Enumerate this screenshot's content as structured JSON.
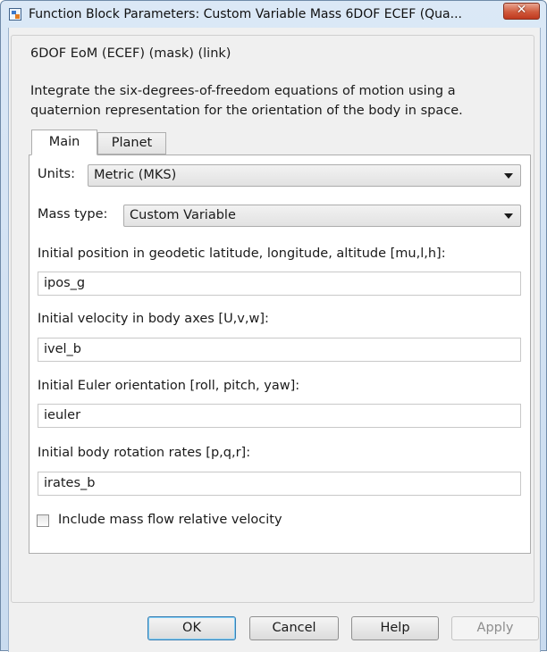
{
  "window": {
    "title": "Function Block Parameters: Custom Variable Mass 6DOF ECEF (Qua...",
    "close_glyph": "✕"
  },
  "block": {
    "group_title": "6DOF EoM (ECEF) (mask) (link)",
    "description_line1": "Integrate the six-degrees-of-freedom equations of motion using a",
    "description_line2": "quaternion representation for the orientation of the body in space."
  },
  "tabs": [
    {
      "label": "Main",
      "selected": true
    },
    {
      "label": "Planet",
      "selected": false
    }
  ],
  "params": {
    "units_label": "Units:",
    "units_value": "Metric (MKS)",
    "mass_type_label": "Mass type:",
    "mass_type_value": "Custom Variable",
    "ipos_label": "Initial position in geodetic latitude, longitude, altitude [mu,l,h]:",
    "ipos_value": "ipos_g",
    "ivel_label": "Initial velocity in body axes [U,v,w]:",
    "ivel_value": "ivel_b",
    "ieuler_label": "Initial Euler orientation [roll, pitch, yaw]:",
    "ieuler_value": "ieuler",
    "irates_label": "Initial body rotation rates [p,q,r]:",
    "irates_value": "irates_b",
    "mass_flow_label": "Include mass flow relative velocity",
    "mass_flow_checked": false
  },
  "buttons": {
    "ok": "OK",
    "cancel": "Cancel",
    "help": "Help",
    "apply": "Apply",
    "apply_enabled": false
  },
  "colors": {
    "title_bar": "#c9dbef",
    "close_button": "#d05a3c",
    "default_button_border": "#3c7fb1",
    "disabled_text": "#8d8d8d"
  },
  "icons": {
    "app": "simulink-block-icon",
    "close": "close-icon",
    "dropdown": "chevron-down-icon"
  }
}
